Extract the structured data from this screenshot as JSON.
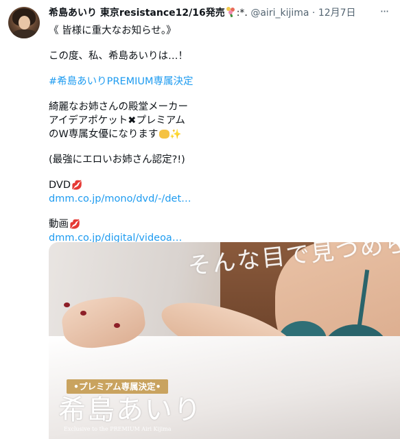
{
  "tweet": {
    "display_name": "希島あいり 東京resistance12/16発売",
    "name_decoration": ":*.",
    "handle": "@airi_kijima",
    "separator": "·",
    "date": "12月7日",
    "more_icon": "more-horizontal-icon",
    "lines": {
      "l1": "《  皆様に重大なお知らせ。》",
      "l2": "この度、私、希島あいりは…！",
      "hashtag": "#希島あいりPREMIUM専属決定",
      "l4": "綺麗なお姉さんの殿堂メーカー",
      "l5a": "アイデアポケット",
      "l5x": "✖",
      "l5b": "プレミアム",
      "l6": "のW専属女優になります",
      "l7": "(最強にエロいお姉さん認定?!)",
      "dvd_label": "DVD",
      "dvd_link": "dmm.co.jp/mono/dvd/-/det…",
      "video_label": "動画",
      "video_link": "dmm.co.jp/digital/videoa…"
    },
    "icons": {
      "bouquet": "bouquet-icon",
      "lips": "lips-icon",
      "hands": "raising-hands-icon",
      "sparkles": "sparkles-icon"
    },
    "media": {
      "headline": "そんな目で見つめられたら",
      "badge": "•プレミアム専属決定•",
      "name": "希島あいり",
      "subtitle": "Exclusive to the PREMIUM  Airi Kijima"
    },
    "colors": {
      "link": "#1d9bf0",
      "muted": "#536471",
      "text": "#0f1419"
    }
  }
}
